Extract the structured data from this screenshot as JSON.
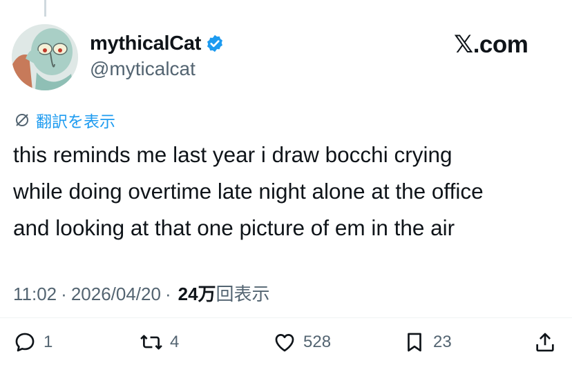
{
  "tweet": {
    "display_name": "mythicalCat",
    "handle": "@myticalcat",
    "site_label": "𝕏.com",
    "translate_label": "翻訳を表示",
    "text": "this reminds me last year i draw bocchi crying\nwhile doing overtime late night alone at the office\nand looking at that one picture of em in the air",
    "time": "11:02",
    "date": "2026/04/20",
    "views_count": "24万",
    "views_label": "回表示"
  },
  "actions": {
    "replies": "1",
    "reposts": "4",
    "likes": "528",
    "bookmarks": "23"
  },
  "colors": {
    "accent": "#1d9bf0",
    "secondary_text": "#536471",
    "primary_text": "#0f1419"
  },
  "icons": [
    "verified-badge-icon",
    "translate-icon",
    "reply-icon",
    "repost-icon",
    "like-icon",
    "bookmark-icon",
    "share-icon"
  ]
}
